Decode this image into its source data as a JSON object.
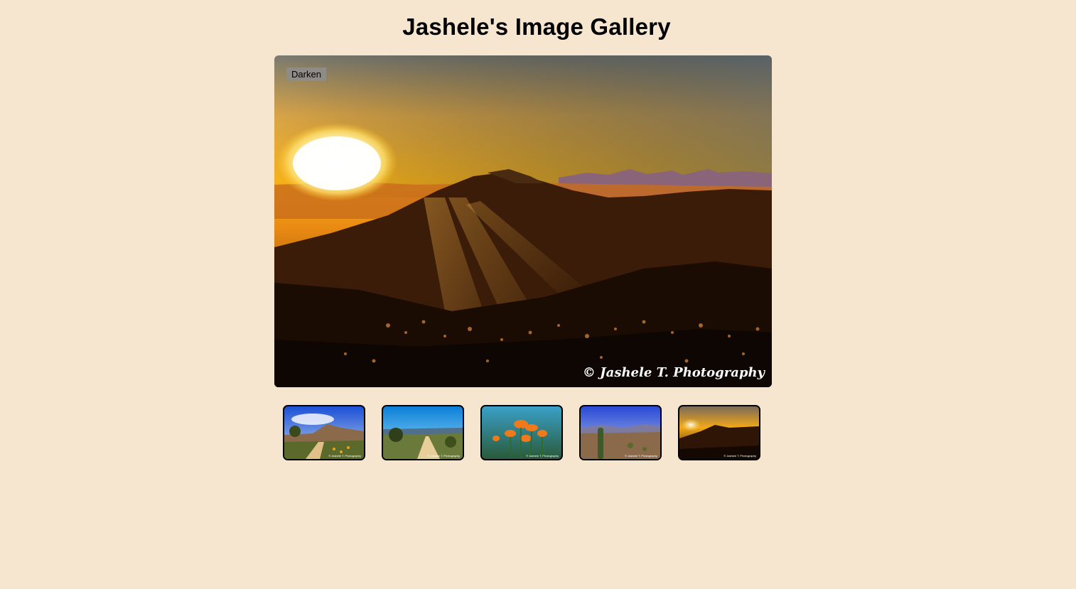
{
  "header": {
    "title": "Jashele's Image Gallery"
  },
  "main_image": {
    "darken_label": "Darken",
    "watermark": "© Jashele T. Photography",
    "alt": "desert sunset over mountains"
  },
  "thumbnails": [
    {
      "subject": "desert trail under blue sky",
      "watermark": "© Jashele T. Photography"
    },
    {
      "subject": "desert path to distant mountains",
      "watermark": "© Jashele T. Photography"
    },
    {
      "subject": "orange wildflowers",
      "watermark": "© Jashele T. Photography"
    },
    {
      "subject": "cactus in desert landscape",
      "watermark": "© Jashele T. Photography"
    },
    {
      "subject": "desert sunset",
      "watermark": "© Jashele T. Photography"
    }
  ],
  "colors": {
    "page_background": "#f7e6cf",
    "button_background": "#8f8c88"
  }
}
